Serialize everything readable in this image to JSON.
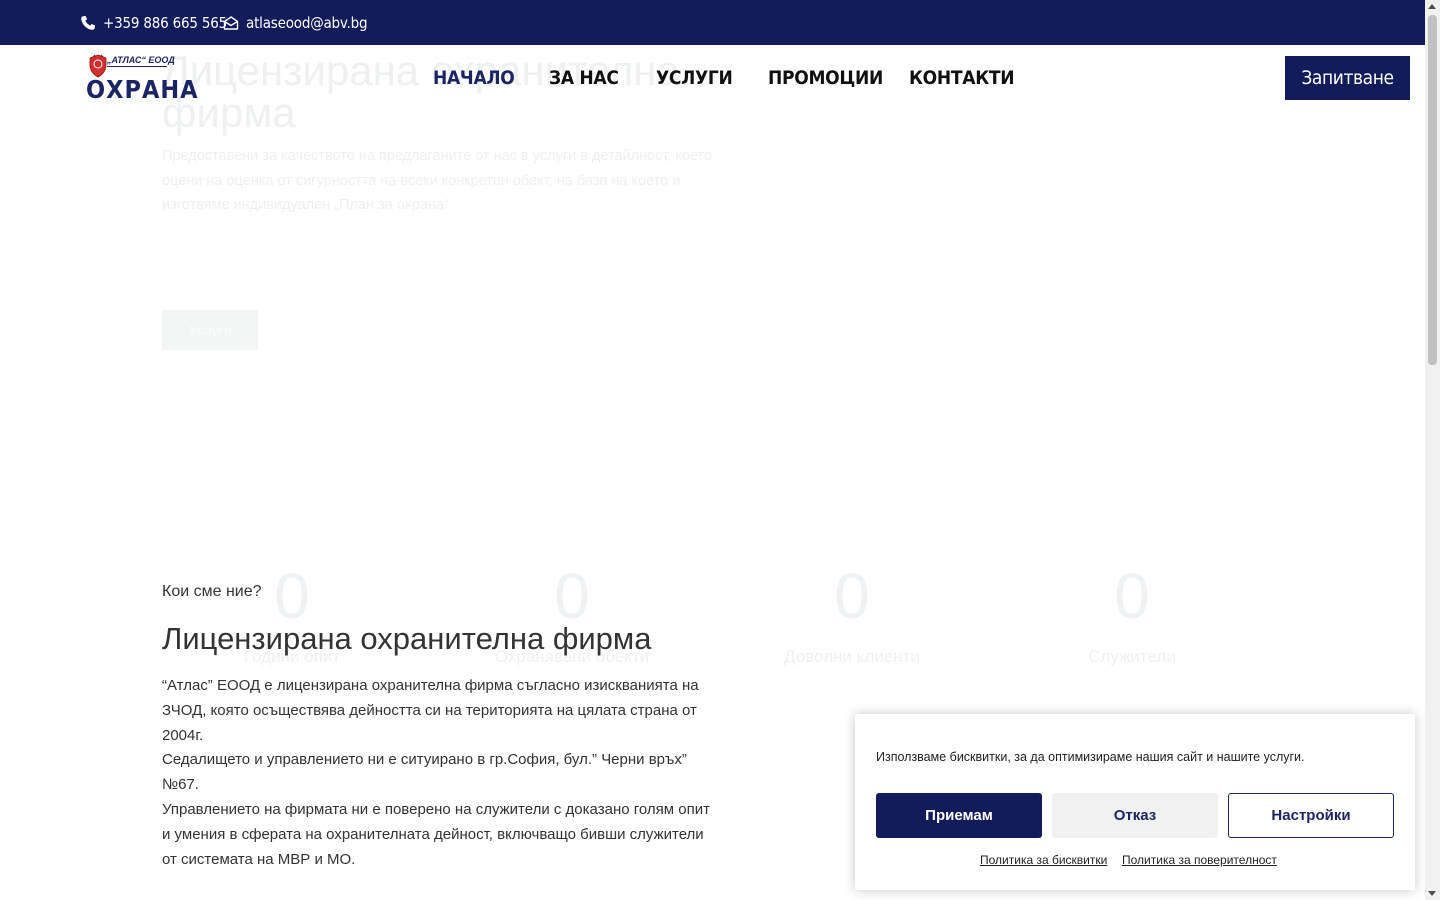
{
  "topbar": {
    "phone": "+359 886 665 565",
    "email": "atlaseood@abv.bg",
    "phone_icon": "phone-icon",
    "email_icon": "envelope-icon"
  },
  "logo": {
    "tagline": "„АТЛАС“ ЕООД",
    "word": "ОХРАНА"
  },
  "nav": {
    "items": [
      {
        "label": "НАЧАЛО",
        "active": true
      },
      {
        "label": "ЗА НАС",
        "active": false
      },
      {
        "label": "УСЛУГИ",
        "active": false
      },
      {
        "label": "ПРОМОЦИИ",
        "active": false
      },
      {
        "label": "КОНТАКТИ",
        "active": false
      }
    ],
    "inquiry_label": "Запитване"
  },
  "hero": {
    "title": "Лицензирана охранителна фирма",
    "text": "Предоставени за качеството на предлаганите от нас в услуги в детайлност, което оцени на оценка от сигурността на всеки конкретен обект, на база на което и изготвяме индивидуален „План за охрана“",
    "button": "Услуги"
  },
  "counters": [
    {
      "num": "0",
      "label": "Години опит"
    },
    {
      "num": "0",
      "label": "Охранявани обекти"
    },
    {
      "num": "0",
      "label": "Доволни клиенти"
    },
    {
      "num": "0",
      "label": "Служители"
    }
  ],
  "about": {
    "eyebrow": "Кои сме ние?",
    "title": "Лицензирана охранителна фирма",
    "p1": "“Атлас” ЕООД е лицензирана охранителна фирма съгласно изискванията на ЗЧОД, която осъществява дейността си на територията на цялата страна от 2004г.",
    "p2": "Седалището и управлението ни е ситуирано в гр.София, бул.” Черни връх” №67.",
    "p3": "Управлението на фирмата ни е поверено на служители с доказано голям опит и умения в сферата на охранителната дейност, включващо бивши служители от системата на МВР и МО."
  },
  "cookie": {
    "message": "Използваме бисквитки, за да оптимизираме нашия сайт и нашите услуги.",
    "accept": "Приемам",
    "deny": "Отказ",
    "preferences": "Настройки",
    "cookie_policy": "Политика за бисквитки",
    "privacy_policy": "Политика за поверителност"
  },
  "colors": {
    "brand": "#131b5b",
    "accent_red": "#d32f2f"
  }
}
